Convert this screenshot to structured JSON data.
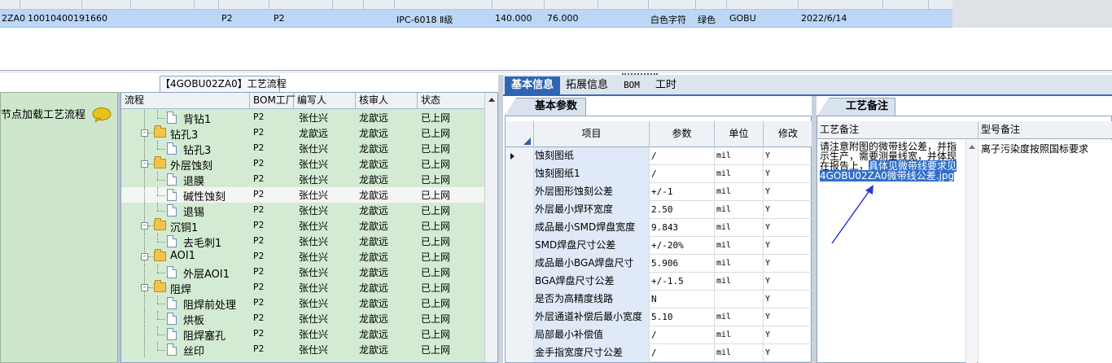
{
  "top_grid": {
    "row": {
      "code": "2ZA0",
      "number": "10010400191660",
      "p1": "P2",
      "p2": "P2",
      "grade": "IPC-6018 Ⅱ级",
      "val1": "140.000",
      "val2": "76.000",
      "char_color": "白色字符",
      "mask_color": "绿色",
      "brand": "GOBU",
      "date": "2022/6/14"
    }
  },
  "left_panel": {
    "label": "节点加载工艺流程",
    "bubble_icon": "speech-bubble-icon"
  },
  "process_flow": {
    "tab_title": "【4GOBU02ZA0】工艺流程",
    "columns": [
      "流程",
      "BOM工厂",
      "编写人",
      "核审人",
      "状态"
    ],
    "rows": [
      {
        "name": "背钻1",
        "type": "doc",
        "level": 2,
        "bom": "P2",
        "writer": "张仕兴",
        "reviewer": "龙歆远",
        "status": "已上网"
      },
      {
        "name": "钻孔3",
        "type": "folder",
        "level": 1,
        "bom": "P2",
        "writer": "龙歆远",
        "reviewer": "龙歆远",
        "status": "已上网"
      },
      {
        "name": "钻孔3",
        "type": "doc",
        "level": 2,
        "bom": "P2",
        "writer": "张仕兴",
        "reviewer": "龙歆远",
        "status": "已上网"
      },
      {
        "name": "外层蚀刻",
        "type": "folder",
        "level": 1,
        "bom": "P2",
        "writer": "张仕兴",
        "reviewer": "龙歆远",
        "status": "已上网"
      },
      {
        "name": "退膜",
        "type": "doc",
        "level": 2,
        "bom": "P2",
        "writer": "张仕兴",
        "reviewer": "龙歆远",
        "status": "已上网"
      },
      {
        "name": "碱性蚀刻",
        "type": "doc",
        "level": 2,
        "bom": "P2",
        "writer": "张仕兴",
        "reviewer": "龙歆远",
        "status": "已上网",
        "selected": true
      },
      {
        "name": "退锡",
        "type": "doc",
        "level": 2,
        "bom": "P2",
        "writer": "张仕兴",
        "reviewer": "龙歆远",
        "status": "已上网"
      },
      {
        "name": "沉铜1",
        "type": "folder",
        "level": 1,
        "bom": "P2",
        "writer": "张仕兴",
        "reviewer": "龙歆远",
        "status": "已上网"
      },
      {
        "name": "去毛刺1",
        "type": "doc",
        "level": 2,
        "bom": "P2",
        "writer": "张仕兴",
        "reviewer": "龙歆远",
        "status": "已上网"
      },
      {
        "name": "AOI1",
        "type": "folder",
        "level": 1,
        "bom": "P2",
        "writer": "张仕兴",
        "reviewer": "龙歆远",
        "status": "已上网"
      },
      {
        "name": "外层AOI1",
        "type": "doc",
        "level": 2,
        "bom": "P2",
        "writer": "张仕兴",
        "reviewer": "龙歆远",
        "status": "已上网"
      },
      {
        "name": "阻焊",
        "type": "folder",
        "level": 1,
        "bom": "P2",
        "writer": "张仕兴",
        "reviewer": "龙歆远",
        "status": "已上网"
      },
      {
        "name": "阻焊前处理",
        "type": "doc",
        "level": 2,
        "bom": "P2",
        "writer": "张仕兴",
        "reviewer": "龙歆远",
        "status": "已上网"
      },
      {
        "name": "烘板",
        "type": "doc",
        "level": 2,
        "bom": "P2",
        "writer": "张仕兴",
        "reviewer": "龙歆远",
        "status": "已上网"
      },
      {
        "name": "阻焊塞孔",
        "type": "doc",
        "level": 2,
        "bom": "P2",
        "writer": "张仕兴",
        "reviewer": "龙歆远",
        "status": "已上网"
      },
      {
        "name": "丝印",
        "type": "doc",
        "level": 2,
        "bom": "P2",
        "writer": "张仕兴",
        "reviewer": "龙歆远",
        "status": "已上网"
      }
    ]
  },
  "right_tabs": {
    "tabs": [
      "基本信息",
      "拓展信息",
      "BOM",
      "工时"
    ],
    "active": 0
  },
  "basic_params": {
    "title": "基本参数",
    "columns": [
      "项目",
      "参数",
      "单位",
      "修改"
    ],
    "rows": [
      {
        "item": "蚀刻图纸",
        "param": "/",
        "unit": "mil",
        "mod": "Y",
        "current": true
      },
      {
        "item": "蚀刻图纸1",
        "param": "/",
        "unit": "mil",
        "mod": "Y"
      },
      {
        "item": "外层图形蚀刻公差",
        "param": "+/-1",
        "unit": "mil",
        "mod": "Y"
      },
      {
        "item": "外层最小焊环宽度",
        "param": "2.50",
        "unit": "mil",
        "mod": "Y"
      },
      {
        "item": "成品最小SMD焊盘宽度",
        "param": "9.843",
        "unit": "mil",
        "mod": "Y"
      },
      {
        "item": "SMD焊盘尺寸公差",
        "param": "+/-20%",
        "unit": "mil",
        "mod": "Y"
      },
      {
        "item": "成品最小BGA焊盘尺寸",
        "param": "5.906",
        "unit": "mil",
        "mod": "Y"
      },
      {
        "item": "BGA焊盘尺寸公差",
        "param": "+/-1.5",
        "unit": "mil",
        "mod": "Y"
      },
      {
        "item": "是否为高精度线路",
        "param": "N",
        "unit": "",
        "mod": "Y"
      },
      {
        "item": "外层通道补偿后最小宽度",
        "param": "5.10",
        "unit": "mil",
        "mod": "Y"
      },
      {
        "item": "局部最小补偿值",
        "param": "/",
        "unit": "mil",
        "mod": "Y"
      },
      {
        "item": "金手指宽度尺寸公差",
        "param": "/",
        "unit": "mil",
        "mod": "Y"
      }
    ]
  },
  "process_remark": {
    "tab_title": "工艺备注",
    "col_remark": "工艺备注",
    "col_model": "型号备注",
    "remark_text": "请注意附图的微带线公差，并指示生产，需要测量线宽，并体现在报告上，",
    "remark_highlight": "具体见微带线要求见4GOBU02ZA0微带线公差.jpg",
    "model_text": "离子污染度按照国标要求"
  }
}
